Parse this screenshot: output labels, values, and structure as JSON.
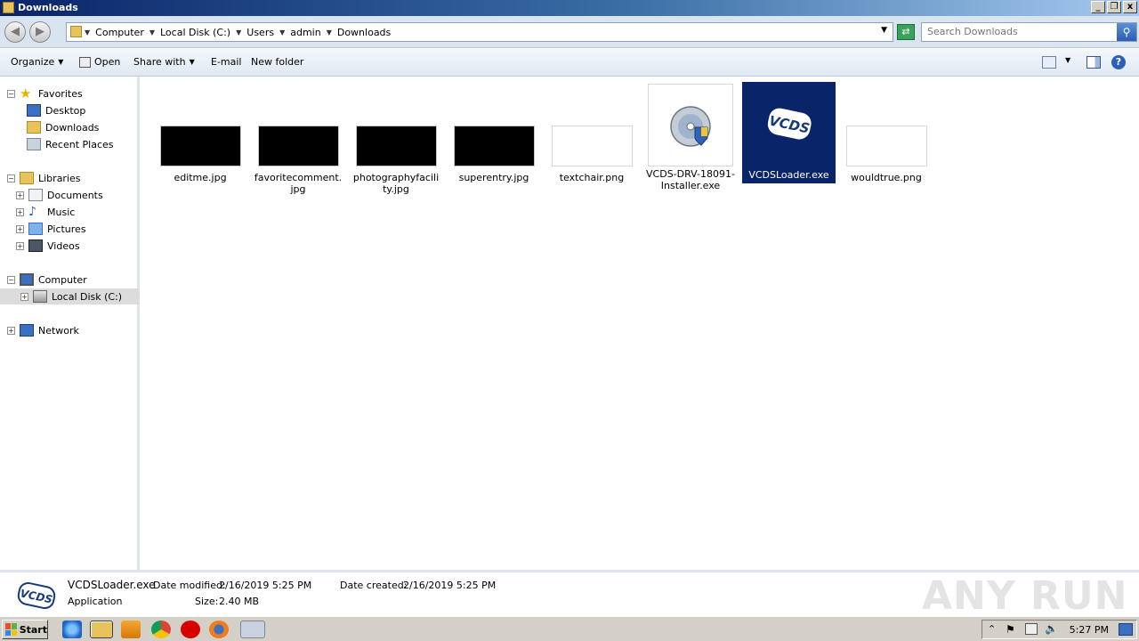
{
  "window": {
    "title": "Downloads",
    "buttons": [
      "_",
      "❐",
      "x"
    ]
  },
  "address": {
    "crumbs": [
      "Computer",
      "Local Disk (C:)",
      "Users",
      "admin",
      "Downloads"
    ],
    "search_placeholder": "Search Downloads"
  },
  "toolbar": {
    "organize": "Organize",
    "open": "Open",
    "share_with": "Share with",
    "email": "E-mail",
    "new_folder": "New folder"
  },
  "nav": {
    "favorites": "Favorites",
    "desktop": "Desktop",
    "downloads": "Downloads",
    "recent_places": "Recent Places",
    "libraries": "Libraries",
    "documents": "Documents",
    "music": "Music",
    "pictures": "Pictures",
    "videos": "Videos",
    "computer": "Computer",
    "local_disk": "Local Disk (C:)",
    "network": "Network"
  },
  "files": [
    {
      "name": "editme.jpg",
      "kind": "dark-thumb"
    },
    {
      "name": "favoritecomment.jpg",
      "kind": "dark-thumb"
    },
    {
      "name": "photographyfacility.jpg",
      "kind": "dark-thumb"
    },
    {
      "name": "superentry.jpg",
      "kind": "dark-thumb"
    },
    {
      "name": "textchair.png",
      "kind": "light-thumb"
    },
    {
      "name": "VCDS-DRV-18091-Installer.exe",
      "kind": "installer-icon"
    },
    {
      "name": "VCDSLoader.exe",
      "kind": "vcds-icon",
      "selected": true
    },
    {
      "name": "wouldtrue.png",
      "kind": "light-thumb"
    }
  ],
  "details": {
    "name": "VCDSLoader.exe",
    "type": "Application",
    "modified_label": "Date modified:",
    "modified_value": "2/16/2019 5:25 PM",
    "created_label": "Date created:",
    "created_value": "2/16/2019 5:25 PM",
    "size_label": "Size:",
    "size_value": "2.40 MB",
    "icon_text": "VCDS"
  },
  "watermark": "ANY RUN",
  "taskbar": {
    "start": "Start",
    "clock": "5:27 PM"
  }
}
